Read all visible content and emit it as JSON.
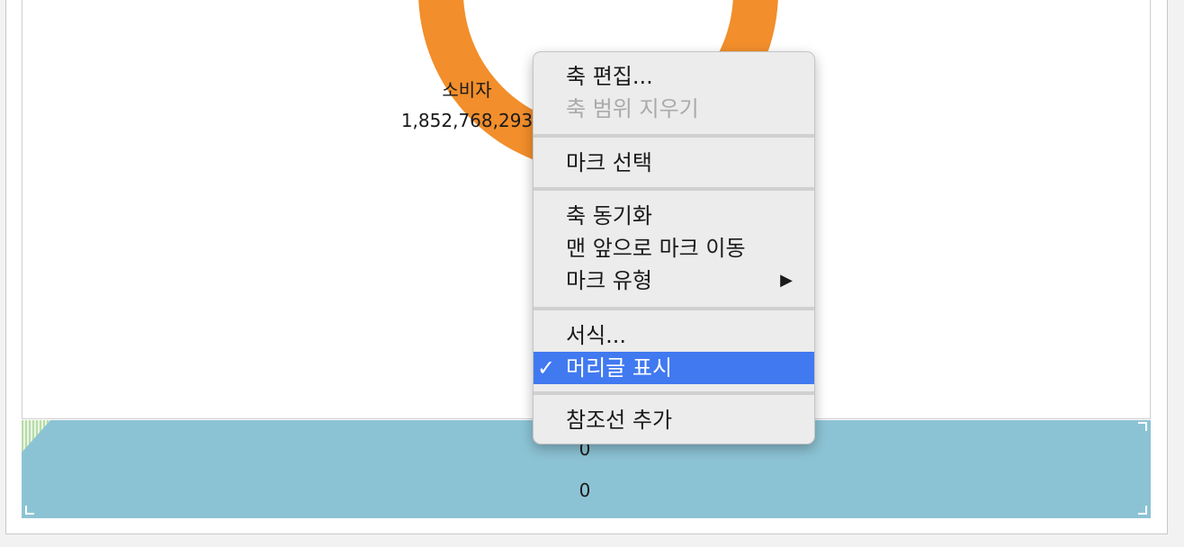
{
  "chart": {
    "slice_label": "소비자",
    "slice_value": "1,852,768,293",
    "slice_color": "#f28e2b",
    "band_color": "#8cc3d4",
    "band_values": [
      "0",
      "0"
    ]
  },
  "menu": {
    "items": [
      {
        "label": "축 편집...",
        "disabled": false
      },
      {
        "label": "축 범위 지우기",
        "disabled": true
      },
      {
        "label": "마크 선택",
        "disabled": false
      },
      {
        "label": "축 동기화",
        "disabled": false
      },
      {
        "label": "맨 앞으로 마크 이동",
        "disabled": false
      },
      {
        "label": "마크 유형",
        "disabled": false,
        "submenu_arrow": "▶"
      },
      {
        "label": "서식...",
        "disabled": false
      },
      {
        "label": "머리글 표시",
        "disabled": false,
        "checked": true,
        "check_mark": "✓",
        "selected": true
      },
      {
        "label": "참조선 추가",
        "disabled": false
      }
    ],
    "highlight_color": "#4179f0"
  }
}
